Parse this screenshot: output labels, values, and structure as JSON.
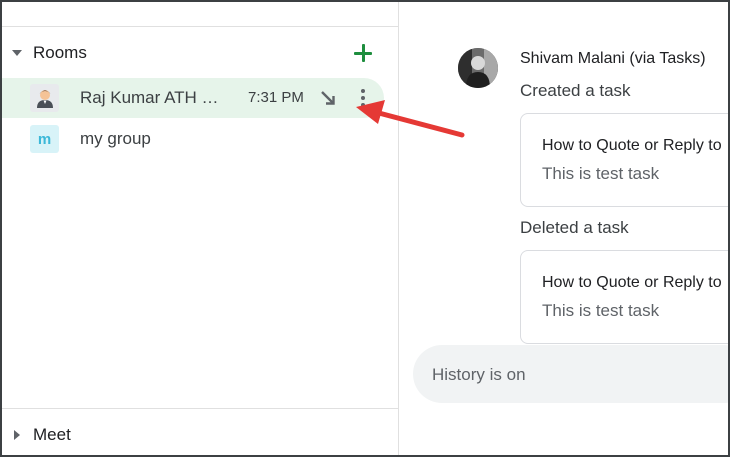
{
  "sidebar": {
    "rooms_title": "Rooms",
    "meet_title": "Meet",
    "rooms": [
      {
        "name": "Raj Kumar ATH …",
        "time": "7:31 PM",
        "avatar_icon": "person-emoji-icon"
      },
      {
        "name": "my group",
        "avatar_letter": "m"
      }
    ]
  },
  "chat": {
    "sender": "Shivam Malani (via Tasks)",
    "events": [
      {
        "text": "Created a task",
        "task_title": "How to Quote or Reply to",
        "task_desc": "This is test task"
      },
      {
        "text": "Deleted a task",
        "task_title": "How to Quote or Reply to",
        "task_desc": "This is test task"
      }
    ],
    "composer_status": "History is on"
  },
  "colors": {
    "accent_green": "#1e8e3e",
    "active_row_bg": "#e6f4ea",
    "annotation_red": "#e53935"
  }
}
